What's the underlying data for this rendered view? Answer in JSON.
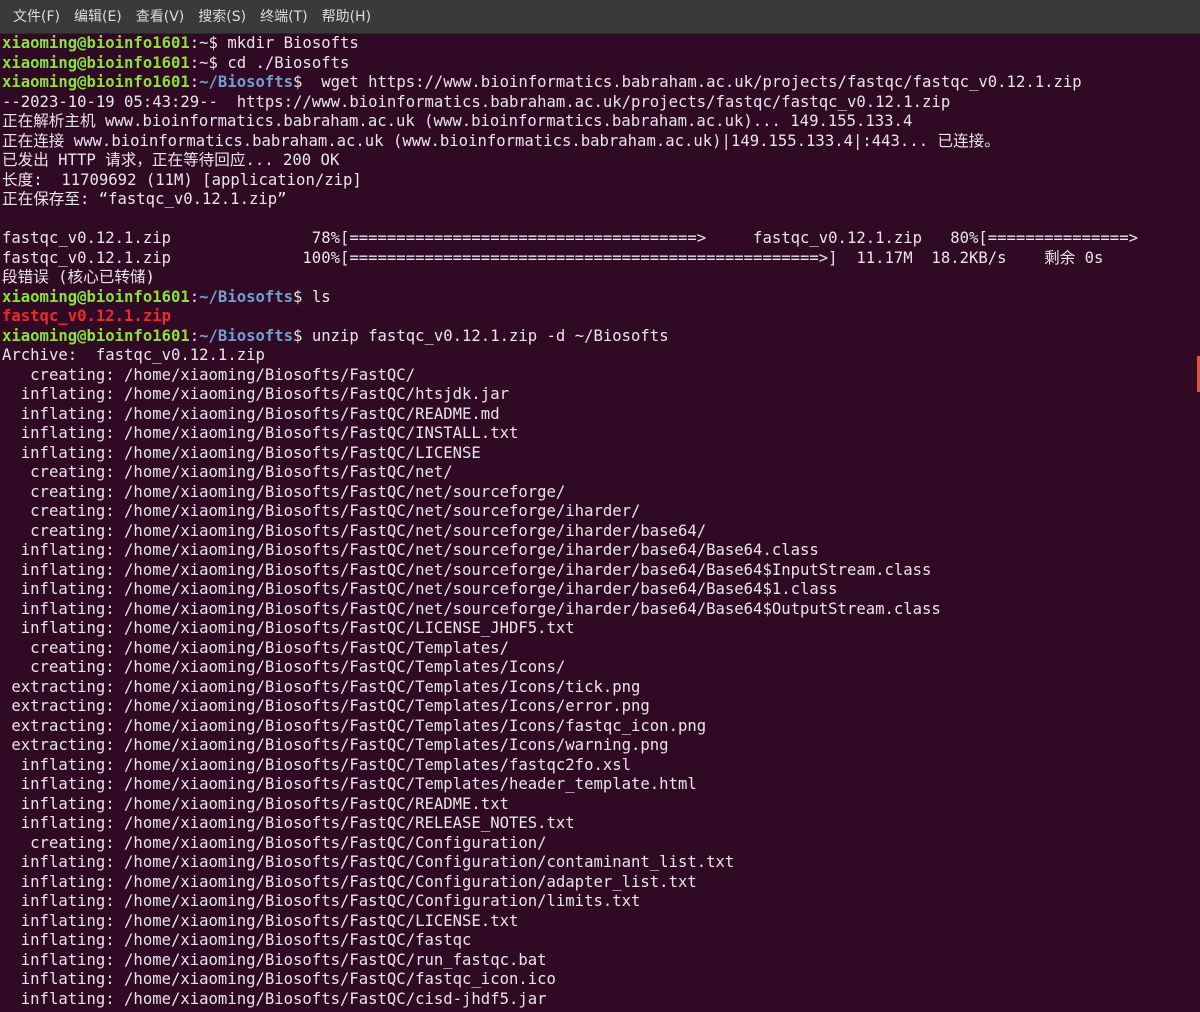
{
  "menu": [
    "文件(F)",
    "编辑(E)",
    "查看(V)",
    "搜索(S)",
    "终端(T)",
    "帮助(H)"
  ],
  "lines": [
    [
      {
        "c": "u",
        "t": "xiaoming@bioinfo1601"
      },
      {
        "c": "t",
        "t": ":~$ mkdir Biosofts"
      }
    ],
    [
      {
        "c": "u",
        "t": "xiaoming@bioinfo1601"
      },
      {
        "c": "t",
        "t": ":~$ cd ./Biosofts"
      }
    ],
    [
      {
        "c": "u",
        "t": "xiaoming@bioinfo1601"
      },
      {
        "c": "t",
        "t": ":"
      },
      {
        "c": "p",
        "t": "~/Biosofts"
      },
      {
        "c": "t",
        "t": "$  wget https://www.bioinformatics.babraham.ac.uk/projects/fastqc/fastqc_v0.12.1.zip"
      }
    ],
    [
      {
        "c": "t",
        "t": "--2023-10-19 05:43:29--  https://www.bioinformatics.babraham.ac.uk/projects/fastqc/fastqc_v0.12.1.zip"
      }
    ],
    [
      {
        "c": "t",
        "t": "正在解析主机 www.bioinformatics.babraham.ac.uk (www.bioinformatics.babraham.ac.uk)... 149.155.133.4"
      }
    ],
    [
      {
        "c": "t",
        "t": "正在连接 www.bioinformatics.babraham.ac.uk (www.bioinformatics.babraham.ac.uk)|149.155.133.4|:443... 已连接。"
      }
    ],
    [
      {
        "c": "t",
        "t": "已发出 HTTP 请求，正在等待回应... 200 OK"
      }
    ],
    [
      {
        "c": "t",
        "t": "长度:  11709692 (11M) [application/zip]"
      }
    ],
    [
      {
        "c": "t",
        "t": "正在保存至: “fastqc_v0.12.1.zip”"
      }
    ],
    [
      {
        "c": "t",
        "t": ""
      }
    ],
    [
      {
        "c": "t",
        "t": "fastqc_v0.12.1.zip               78%[=====================================>     fastqc_v0.12.1.zip   80%[===============>"
      }
    ],
    [
      {
        "c": "t",
        "t": "fastqc_v0.12.1.zip              100%[==================================================>]  11.17M  18.2KB/s    剩余 0s"
      }
    ],
    [
      {
        "c": "t",
        "t": "段错误 (核心已转储)"
      }
    ],
    [
      {
        "c": "u",
        "t": "xiaoming@bioinfo1601"
      },
      {
        "c": "t",
        "t": ":"
      },
      {
        "c": "p",
        "t": "~/Biosofts"
      },
      {
        "c": "t",
        "t": "$ ls"
      }
    ],
    [
      {
        "c": "r",
        "t": "fastqc_v0.12.1.zip"
      }
    ],
    [
      {
        "c": "u",
        "t": "xiaoming@bioinfo1601"
      },
      {
        "c": "t",
        "t": ":"
      },
      {
        "c": "p",
        "t": "~/Biosofts"
      },
      {
        "c": "t",
        "t": "$ unzip fastqc_v0.12.1.zip -d ~/Biosofts"
      }
    ],
    [
      {
        "c": "t",
        "t": "Archive:  fastqc_v0.12.1.zip"
      }
    ],
    [
      {
        "c": "t",
        "t": "   creating: /home/xiaoming/Biosofts/FastQC/"
      }
    ],
    [
      {
        "c": "t",
        "t": "  inflating: /home/xiaoming/Biosofts/FastQC/htsjdk.jar"
      }
    ],
    [
      {
        "c": "t",
        "t": "  inflating: /home/xiaoming/Biosofts/FastQC/README.md"
      }
    ],
    [
      {
        "c": "t",
        "t": "  inflating: /home/xiaoming/Biosofts/FastQC/INSTALL.txt"
      }
    ],
    [
      {
        "c": "t",
        "t": "  inflating: /home/xiaoming/Biosofts/FastQC/LICENSE"
      }
    ],
    [
      {
        "c": "t",
        "t": "   creating: /home/xiaoming/Biosofts/FastQC/net/"
      }
    ],
    [
      {
        "c": "t",
        "t": "   creating: /home/xiaoming/Biosofts/FastQC/net/sourceforge/"
      }
    ],
    [
      {
        "c": "t",
        "t": "   creating: /home/xiaoming/Biosofts/FastQC/net/sourceforge/iharder/"
      }
    ],
    [
      {
        "c": "t",
        "t": "   creating: /home/xiaoming/Biosofts/FastQC/net/sourceforge/iharder/base64/"
      }
    ],
    [
      {
        "c": "t",
        "t": "  inflating: /home/xiaoming/Biosofts/FastQC/net/sourceforge/iharder/base64/Base64.class"
      }
    ],
    [
      {
        "c": "t",
        "t": "  inflating: /home/xiaoming/Biosofts/FastQC/net/sourceforge/iharder/base64/Base64$InputStream.class"
      }
    ],
    [
      {
        "c": "t",
        "t": "  inflating: /home/xiaoming/Biosofts/FastQC/net/sourceforge/iharder/base64/Base64$1.class"
      }
    ],
    [
      {
        "c": "t",
        "t": "  inflating: /home/xiaoming/Biosofts/FastQC/net/sourceforge/iharder/base64/Base64$OutputStream.class"
      }
    ],
    [
      {
        "c": "t",
        "t": "  inflating: /home/xiaoming/Biosofts/FastQC/LICENSE_JHDF5.txt"
      }
    ],
    [
      {
        "c": "t",
        "t": "   creating: /home/xiaoming/Biosofts/FastQC/Templates/"
      }
    ],
    [
      {
        "c": "t",
        "t": "   creating: /home/xiaoming/Biosofts/FastQC/Templates/Icons/"
      }
    ],
    [
      {
        "c": "t",
        "t": " extracting: /home/xiaoming/Biosofts/FastQC/Templates/Icons/tick.png"
      }
    ],
    [
      {
        "c": "t",
        "t": " extracting: /home/xiaoming/Biosofts/FastQC/Templates/Icons/error.png"
      }
    ],
    [
      {
        "c": "t",
        "t": " extracting: /home/xiaoming/Biosofts/FastQC/Templates/Icons/fastqc_icon.png"
      }
    ],
    [
      {
        "c": "t",
        "t": " extracting: /home/xiaoming/Biosofts/FastQC/Templates/Icons/warning.png"
      }
    ],
    [
      {
        "c": "t",
        "t": "  inflating: /home/xiaoming/Biosofts/FastQC/Templates/fastqc2fo.xsl"
      }
    ],
    [
      {
        "c": "t",
        "t": "  inflating: /home/xiaoming/Biosofts/FastQC/Templates/header_template.html"
      }
    ],
    [
      {
        "c": "t",
        "t": "  inflating: /home/xiaoming/Biosofts/FastQC/README.txt"
      }
    ],
    [
      {
        "c": "t",
        "t": "  inflating: /home/xiaoming/Biosofts/FastQC/RELEASE_NOTES.txt"
      }
    ],
    [
      {
        "c": "t",
        "t": "   creating: /home/xiaoming/Biosofts/FastQC/Configuration/"
      }
    ],
    [
      {
        "c": "t",
        "t": "  inflating: /home/xiaoming/Biosofts/FastQC/Configuration/contaminant_list.txt"
      }
    ],
    [
      {
        "c": "t",
        "t": "  inflating: /home/xiaoming/Biosofts/FastQC/Configuration/adapter_list.txt"
      }
    ],
    [
      {
        "c": "t",
        "t": "  inflating: /home/xiaoming/Biosofts/FastQC/Configuration/limits.txt"
      }
    ],
    [
      {
        "c": "t",
        "t": "  inflating: /home/xiaoming/Biosofts/FastQC/LICENSE.txt"
      }
    ],
    [
      {
        "c": "t",
        "t": "  inflating: /home/xiaoming/Biosofts/FastQC/fastqc"
      }
    ],
    [
      {
        "c": "t",
        "t": "  inflating: /home/xiaoming/Biosofts/FastQC/run_fastqc.bat"
      }
    ],
    [
      {
        "c": "t",
        "t": "  inflating: /home/xiaoming/Biosofts/FastQC/fastqc_icon.ico"
      }
    ],
    [
      {
        "c": "t",
        "t": "  inflating: /home/xiaoming/Biosofts/FastQC/cisd-jhdf5.jar"
      }
    ]
  ]
}
